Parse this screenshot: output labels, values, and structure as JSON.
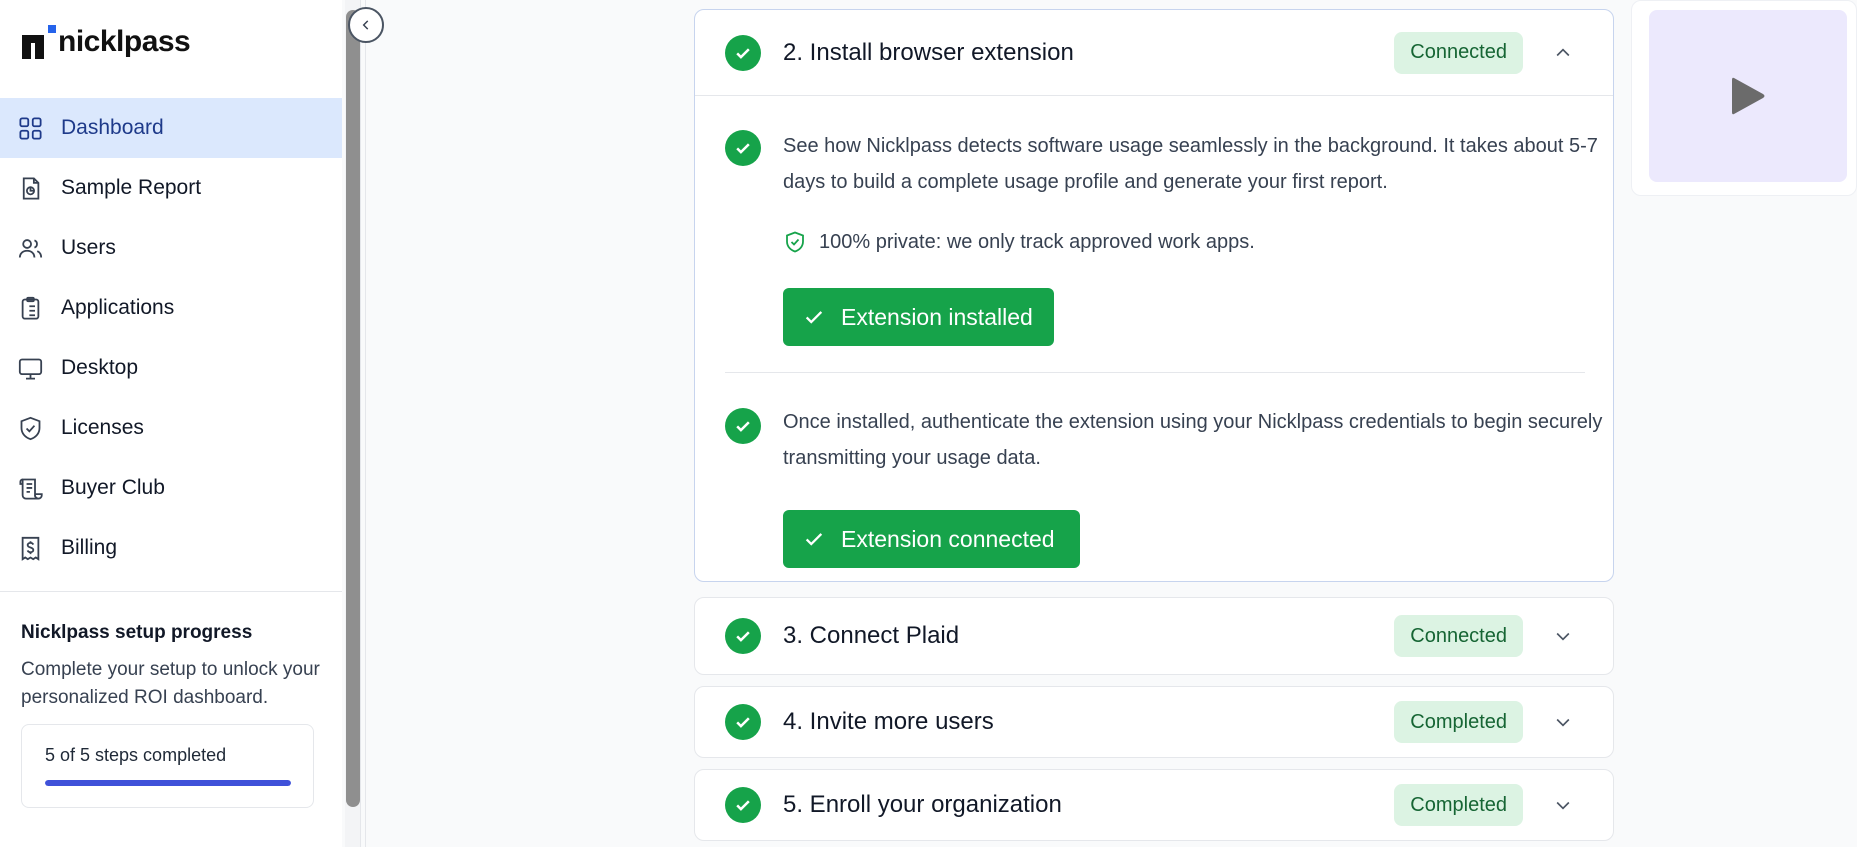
{
  "brand": {
    "name": "nicklpass"
  },
  "sidebar": {
    "items": [
      {
        "label": "Dashboard",
        "icon": "dashboard-grid-icon",
        "active": true
      },
      {
        "label": "Sample Report",
        "icon": "report-icon",
        "active": false
      },
      {
        "label": "Users",
        "icon": "users-icon",
        "active": false
      },
      {
        "label": "Applications",
        "icon": "clipboard-icon",
        "active": false
      },
      {
        "label": "Desktop",
        "icon": "monitor-icon",
        "active": false
      },
      {
        "label": "Licenses",
        "icon": "shield-check-icon",
        "active": false
      },
      {
        "label": "Buyer Club",
        "icon": "scroll-icon",
        "active": false
      },
      {
        "label": "Billing",
        "icon": "receipt-dollar-icon",
        "active": false
      }
    ],
    "progress": {
      "title": "Nicklpass setup progress",
      "description": "Complete your setup to unlock your personalized ROI dashboard.",
      "status": "5 of 5 steps completed",
      "fraction": 1.0
    }
  },
  "steps": {
    "step2": {
      "title": "2. Install browser extension",
      "badge": "Connected",
      "sub1_text": "See how Nicklpass detects software usage seamlessly in the background. It takes about 5-7 days to build a complete usage profile and generate your first report.",
      "private_note": "100% private: we only track approved work apps.",
      "button1": "Extension installed",
      "sub2_text": "Once installed, authenticate the extension using your Nicklpass credentials to begin securely transmitting your usage data.",
      "button2": "Extension connected"
    },
    "step3": {
      "title": "3. Connect Plaid",
      "badge": "Connected"
    },
    "step4": {
      "title": "4. Invite more users",
      "badge": "Completed"
    },
    "step5": {
      "title": "5. Enroll your organization",
      "badge": "Completed"
    }
  },
  "colors": {
    "accent_green": "#16a34a",
    "badge_bg": "#dcf3e3",
    "active_nav_bg": "#dbe8fd",
    "progress_fill": "#3f51d9",
    "video_bg": "#ece9fd"
  }
}
